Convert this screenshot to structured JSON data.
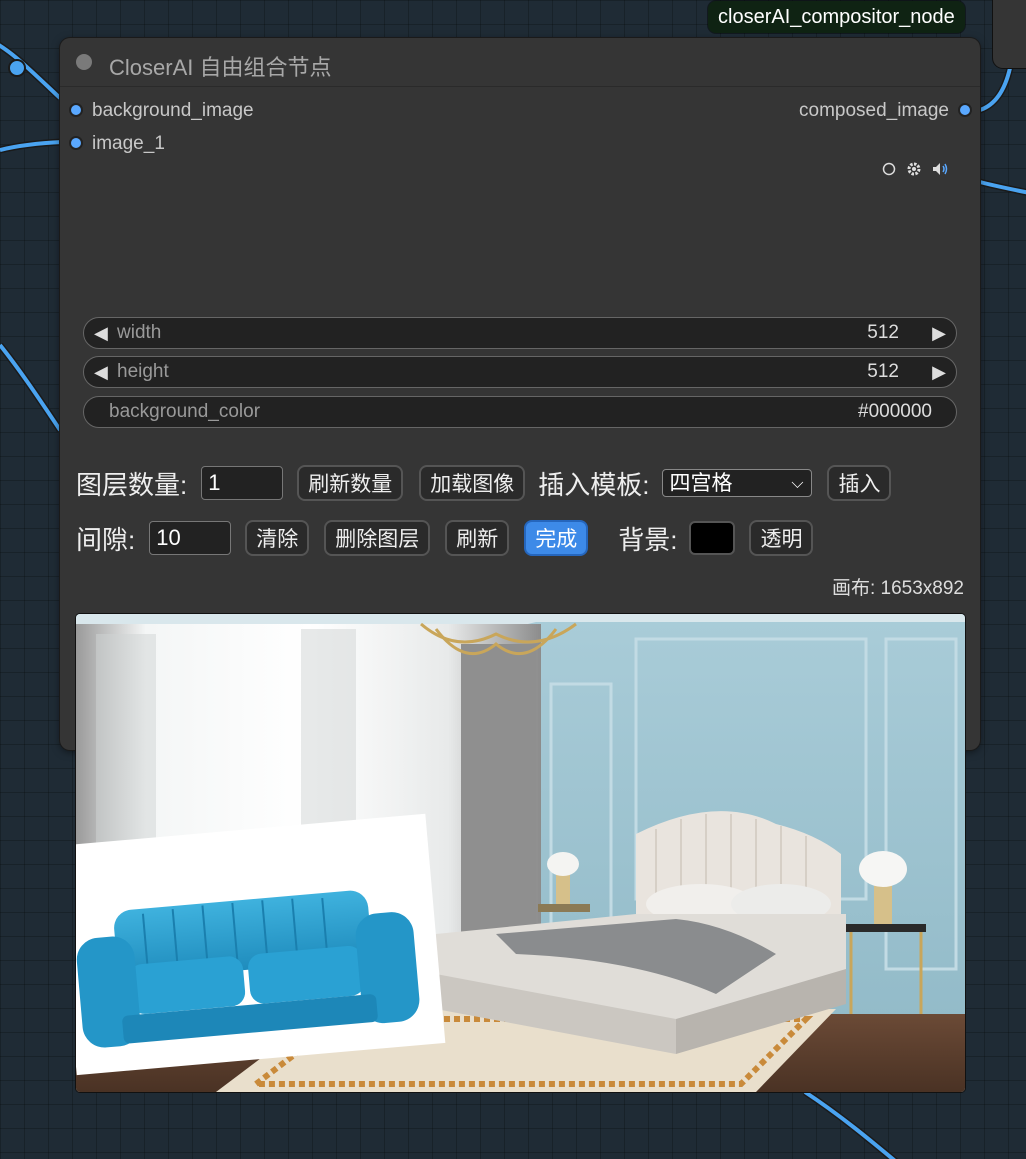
{
  "node": {
    "badge": "closerAI_compositor_node",
    "title": "CloserAI 自由组合节点",
    "inputs": [
      "background_image",
      "image_1"
    ],
    "outputs": [
      "composed_image"
    ]
  },
  "widgets": {
    "width": {
      "label": "width",
      "value": "512"
    },
    "height": {
      "label": "height",
      "value": "512"
    },
    "background_color": {
      "label": "background_color",
      "value": "#000000"
    }
  },
  "controls": {
    "layer_count_label": "图层数量:",
    "layer_count_value": "1",
    "refresh_count": "刷新数量",
    "load_image": "加载图像",
    "insert_template_label": "插入模板:",
    "template_selected": "四宫格",
    "insert": "插入",
    "gap_label": "间隙:",
    "gap_value": "10",
    "clear": "清除",
    "delete_layer": "删除图层",
    "refresh": "刷新",
    "done": "完成",
    "background_label": "背景:",
    "transparent": "透明",
    "background_swatch_color": "#000000",
    "canvas_info": "画布: 1653x892"
  },
  "colors": {
    "accent": "#3d8ae8",
    "slot_dot": "#5aa8ff",
    "link": "#4aa3f0",
    "badge_bg": "#0f2313"
  },
  "icons": [
    "circle-icon",
    "gear-icon",
    "speaker-icon"
  ]
}
